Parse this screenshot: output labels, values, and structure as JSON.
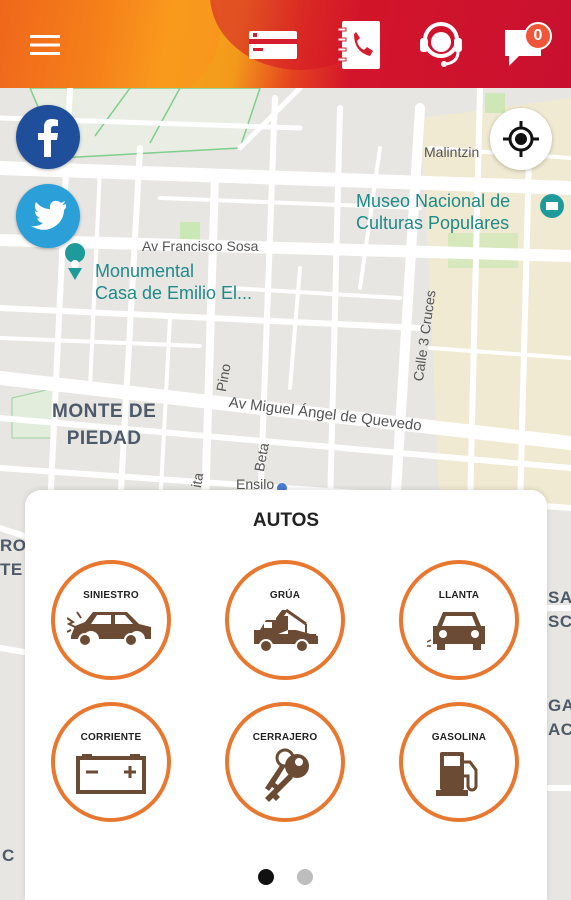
{
  "header": {
    "menu_icon": "hamburger-icon",
    "card_icon": "credit-card-icon",
    "contacts_icon": "phone-book-icon",
    "support_icon": "headset-agent-icon",
    "messages_icon": "chat-bubble-icon",
    "messages_count": "0"
  },
  "social": {
    "facebook_icon": "facebook-icon",
    "twitter_icon": "twitter-icon"
  },
  "map": {
    "locate_icon": "crosshair-location-icon",
    "labels": {
      "malintzin": "Malintzin",
      "museo": "Museo Nacional de\nCulturas Populares",
      "francisco_sosa": "Av Francisco Sosa",
      "monumental": "Monumental\nCasa de Emilio El...",
      "pino": "Pino",
      "tres_cruces": "Calle 3 Cruces",
      "monte_de_piedad": "MONTE DE\nPIEDAD",
      "quevedo": "Av Miguel Ángel de Quevedo",
      "beta": "Beta",
      "ensilo": "Ensilo",
      "ita": "ita",
      "edge_left_top": "ROI\nTE",
      "edge_right_top": "SA\nSC",
      "edge_right_bottom": "GA\nAC",
      "edge_left_bottom": "C"
    },
    "colors": {
      "poi": "#1f8a8a",
      "park": "#c9e8b5"
    }
  },
  "panel": {
    "title": "AUTOS",
    "services": [
      {
        "label": "SINIESTRO",
        "icon": "crashed-car-icon"
      },
      {
        "label": "GRÚA",
        "icon": "tow-truck-icon"
      },
      {
        "label": "LLANTA",
        "icon": "flat-tire-car-icon"
      },
      {
        "label": "CORRIENTE",
        "icon": "car-battery-icon"
      },
      {
        "label": "CERRAJERO",
        "icon": "keys-icon"
      },
      {
        "label": "GASOLINA",
        "icon": "fuel-pump-icon"
      }
    ],
    "pages": [
      {
        "active": true
      },
      {
        "active": false
      }
    ],
    "colors": {
      "ring": "#e8782f",
      "icon": "#6b4b33"
    }
  }
}
